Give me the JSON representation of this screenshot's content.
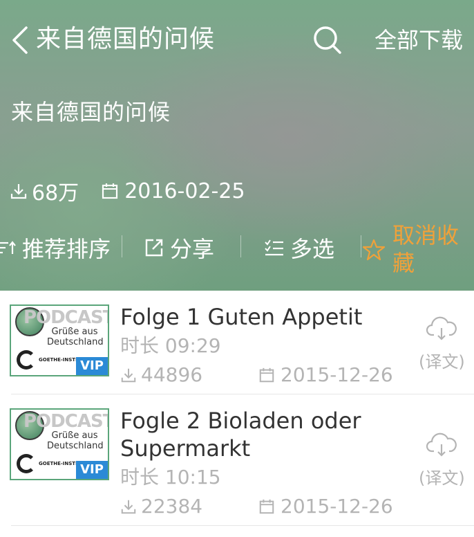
{
  "header": {
    "back_icon": "chevron-left-icon",
    "title": "来自德国的问候",
    "search_icon": "search-icon",
    "download_all_label": "全部下载"
  },
  "album": {
    "title": "来自德国的问候",
    "downloads": "68万",
    "date": "2016-02-25"
  },
  "toolbar": {
    "sort_label": "推荐排序",
    "share_label": "分享",
    "multiselect_label": "多选",
    "unfavorite_label": "取消收藏",
    "favorite_color": "#f0a13a"
  },
  "episodes": [
    {
      "title": "Folge 1 Guten Appetit",
      "duration": "时长 09:29",
      "plays": "44896",
      "date": "2015-12-26",
      "translation_label": "(译文)",
      "cover_brand": "PODCAST",
      "cover_subtitle": "Grüße aus Deutschland",
      "cover_publisher": "GOETHE-INSTITUT",
      "cover_badge": "VIP"
    },
    {
      "title": "Fogle 2 Bioladen oder Supermarkt",
      "duration": "时长 10:15",
      "plays": "22384",
      "date": "2015-12-26",
      "translation_label": "(译文)",
      "cover_brand": "PODCAST",
      "cover_subtitle": "Grüße aus Deutschland",
      "cover_publisher": "GOETHE-INSTITUT",
      "cover_badge": "VIP"
    }
  ],
  "colors": {
    "hero_green": "#7aa98a",
    "accent_orange": "#f0a13a",
    "vip_blue": "#2b8ad6",
    "meta_gray": "#b4b4b4"
  }
}
